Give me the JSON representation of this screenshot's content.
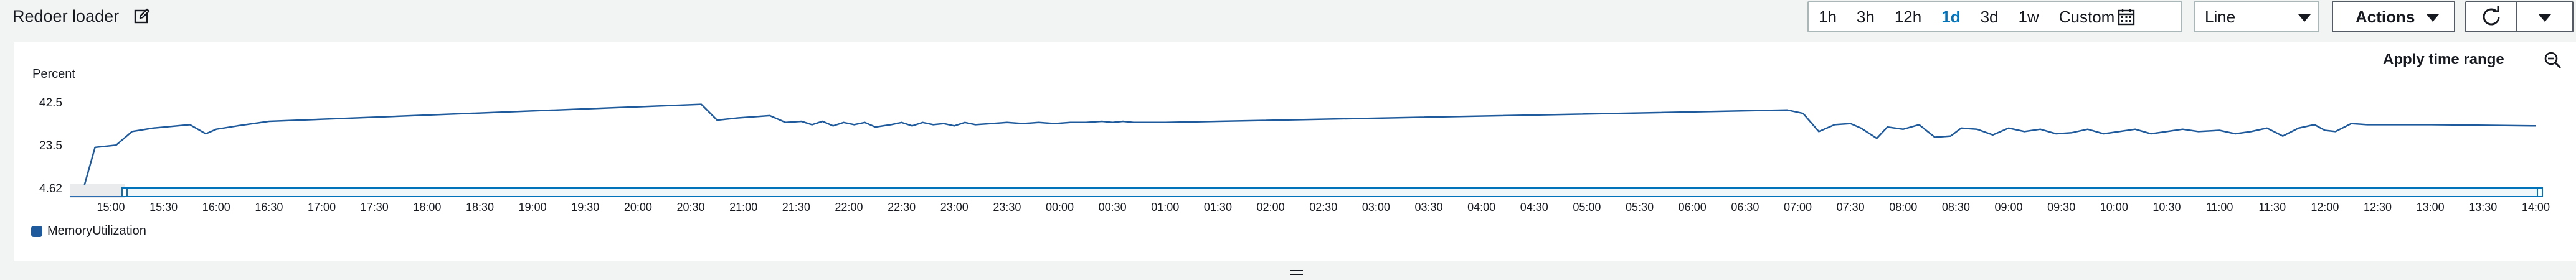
{
  "widget": {
    "title": "Redoer loader",
    "time_ranges": [
      {
        "label": "1h"
      },
      {
        "label": "3h"
      },
      {
        "label": "12h"
      },
      {
        "label": "1d",
        "active": true
      },
      {
        "label": "3d"
      },
      {
        "label": "1w"
      },
      {
        "label": "Custom"
      }
    ],
    "chart_type_select": "Line",
    "actions_label": "Actions",
    "apply_time_range": "Apply time range"
  },
  "chart_data": {
    "type": "line",
    "ylabel": "Percent",
    "y_ticks": [
      "42.5",
      "23.5",
      "4.62"
    ],
    "ylim": [
      4.62,
      42.5
    ],
    "x_ticks": [
      "15:00",
      "15:30",
      "16:00",
      "16:30",
      "17:00",
      "17:30",
      "18:00",
      "18:30",
      "19:00",
      "19:30",
      "20:00",
      "20:30",
      "21:00",
      "21:30",
      "22:00",
      "22:30",
      "23:00",
      "23:30",
      "00:00",
      "00:30",
      "01:00",
      "01:30",
      "02:00",
      "02:30",
      "03:00",
      "03:30",
      "04:00",
      "04:30",
      "05:00",
      "05:30",
      "06:00",
      "06:30",
      "07:00",
      "07:30",
      "08:00",
      "08:30",
      "09:00",
      "09:30",
      "10:00",
      "10:30",
      "11:00",
      "11:30",
      "12:00",
      "12:30",
      "13:00",
      "13:30",
      "14:00"
    ],
    "x_range_hours": [
      14.67,
      38.0
    ],
    "series": [
      {
        "name": "MemoryUtilization",
        "color": "#1f5b9c",
        "x_hours": [
          14.75,
          14.85,
          15.05,
          15.2,
          15.4,
          15.75,
          15.9,
          16.0,
          16.2,
          16.5,
          20.6,
          20.75,
          20.95,
          21.25,
          21.4,
          21.55,
          21.65,
          21.75,
          21.85,
          21.95,
          22.05,
          22.15,
          22.25,
          22.4,
          22.5,
          22.6,
          22.7,
          22.8,
          22.9,
          23.0,
          23.1,
          23.2,
          23.35,
          23.5,
          23.65,
          23.8,
          23.95,
          24.1,
          24.25,
          24.4,
          24.5,
          24.6,
          24.7,
          24.85,
          25.0,
          25.5,
          30.9,
          31.05,
          31.2,
          31.35,
          31.5,
          31.6,
          31.75,
          31.85,
          32.0,
          32.15,
          32.3,
          32.45,
          32.55,
          32.7,
          32.85,
          33.0,
          33.15,
          33.3,
          33.45,
          33.6,
          33.75,
          33.9,
          34.05,
          34.2,
          34.35,
          34.5,
          34.65,
          34.8,
          35.0,
          35.15,
          35.3,
          35.45,
          35.6,
          35.75,
          35.9,
          36.0,
          36.1,
          36.25,
          36.4,
          36.5,
          36.75,
          37.0,
          38.0
        ],
        "values": [
          6.0,
          22.5,
          23.5,
          29.5,
          31.0,
          32.5,
          28.5,
          30.5,
          32.0,
          34.0,
          41.5,
          34.5,
          35.5,
          36.5,
          33.5,
          34.0,
          32.5,
          34.0,
          32.0,
          33.5,
          32.5,
          33.5,
          31.5,
          32.5,
          33.5,
          32.0,
          33.5,
          32.5,
          33.0,
          32.0,
          33.5,
          32.5,
          33.0,
          33.5,
          33.0,
          33.5,
          33.0,
          33.5,
          33.5,
          34.0,
          33.5,
          34.0,
          33.5,
          33.5,
          33.5,
          34.0,
          39.0,
          37.5,
          29.5,
          32.5,
          33.0,
          31.0,
          26.5,
          31.5,
          30.5,
          32.5,
          27.0,
          27.5,
          31.0,
          30.5,
          28.0,
          31.0,
          29.5,
          30.5,
          28.5,
          29.0,
          30.5,
          28.5,
          29.5,
          30.5,
          28.5,
          29.5,
          30.5,
          29.5,
          30.0,
          28.5,
          29.5,
          31.0,
          27.5,
          31.0,
          32.5,
          30.0,
          29.5,
          33.0,
          32.5,
          32.5,
          32.5,
          32.5,
          32.0
        ]
      }
    ],
    "legend": [
      "MemoryUtilization"
    ],
    "legend_position": "bottom-left",
    "grid": false
  },
  "colors": {
    "accent": "#0073bb",
    "series": "#1f5b9c",
    "border": "#aab7b8"
  },
  "icons": {
    "edit": "edit-icon",
    "calendar": "calendar-icon",
    "refresh": "refresh-icon",
    "zoom_out": "zoom-out-icon",
    "caret": "caret-down-icon"
  }
}
